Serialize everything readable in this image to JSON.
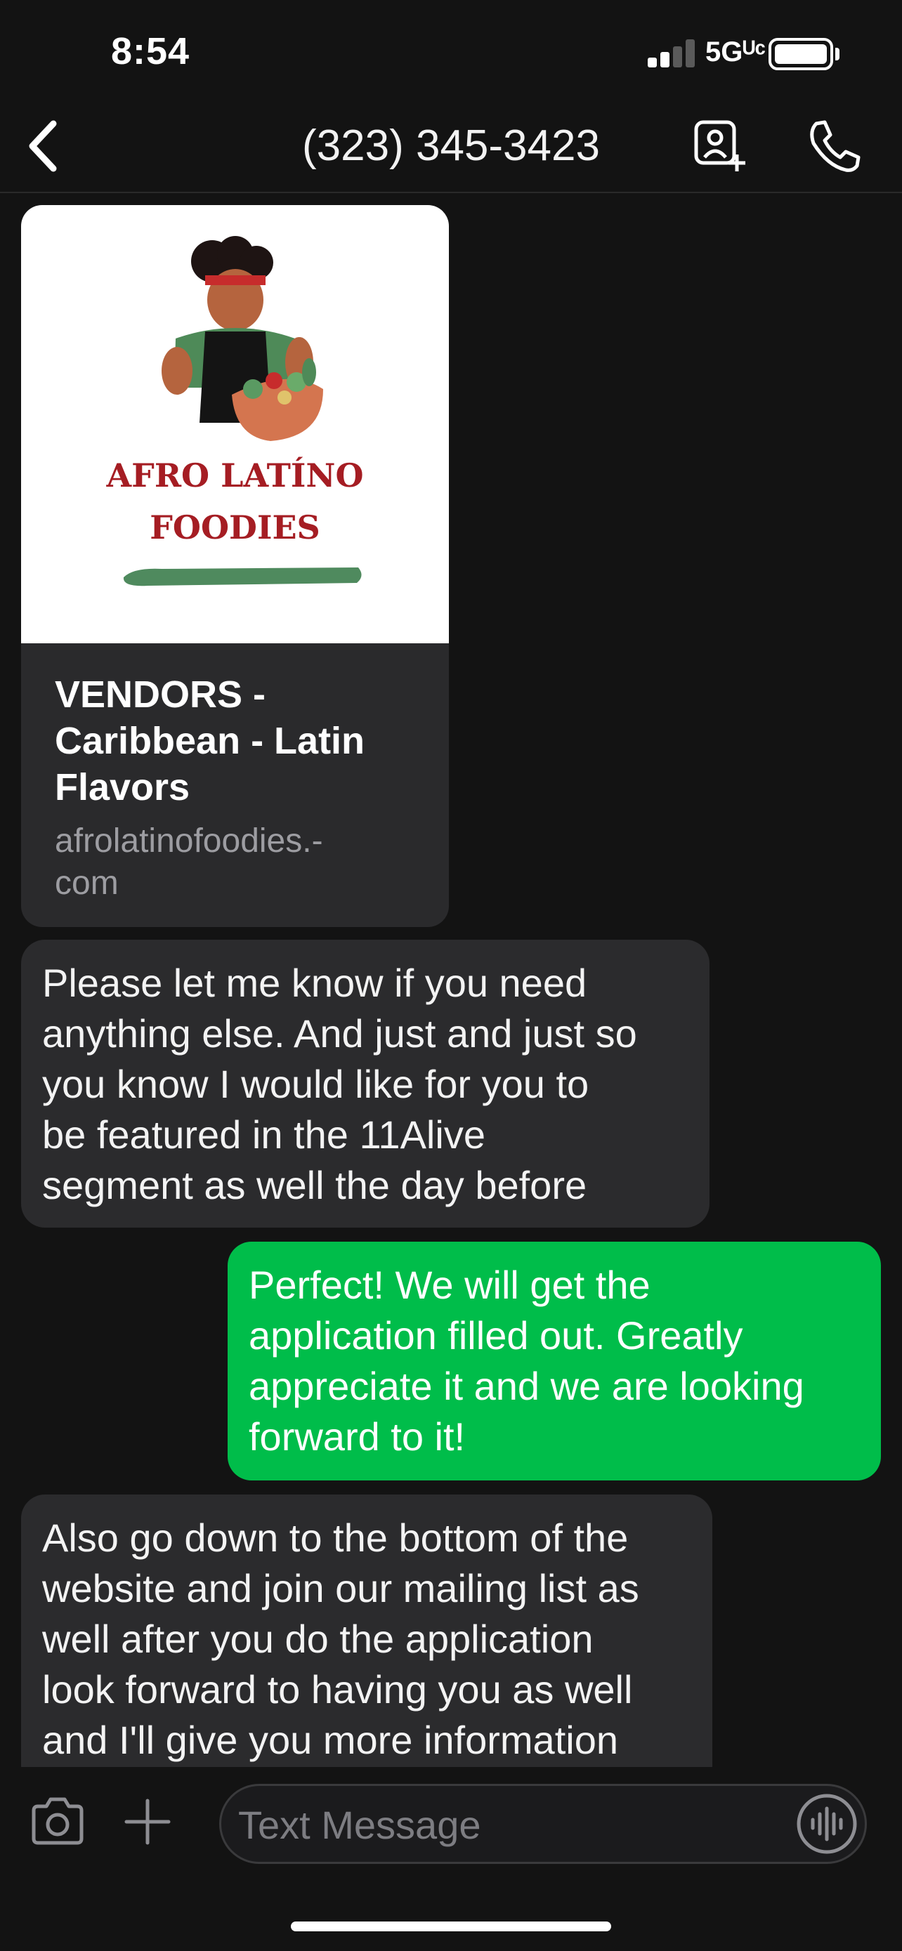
{
  "status_bar": {
    "time": "8:54",
    "network": "5Gᵁᶜ",
    "signal_bars_active": 2,
    "signal_bars_total": 4,
    "battery_level": 1.0
  },
  "header": {
    "title": "(323) 345-3423",
    "back_icon": "chevron-left",
    "add_contact_icon": "person-badge-plus",
    "call_icon": "phone"
  },
  "messages": {
    "link_preview": {
      "logo_line1": "AFRO LATÍNO",
      "logo_line2": "FOODIES",
      "title": "VENDORS - Caribbean - Latin Flavors",
      "url": "afrolatinofoodies.-\ncom"
    },
    "bubble1": "Please let me know if you need\nanything else. And just and just so\nyou know I would like for you to\nbe featured in the 11Alive\nsegment as well the day before",
    "bubble2": "Perfect! We will get the\napplication filled out. Greatly\nappreciate it and we are looking\nforward to it!",
    "bubble3": "Also go down to the bottom of the\nwebsite and join our mailing list as\nwell after you do the application\nlook forward to having you as well\nand I'll give you more information"
  },
  "composer": {
    "placeholder": "Text Message",
    "camera_icon": "camera",
    "plus_icon": "plus",
    "audio_icon": "waveform"
  },
  "colors": {
    "background": "#131313",
    "received_bubble": "#2b2b2d",
    "sent_bubble": "#00bd4a",
    "logo_red": "#a51d23",
    "logo_green": "#4f8a5e"
  }
}
